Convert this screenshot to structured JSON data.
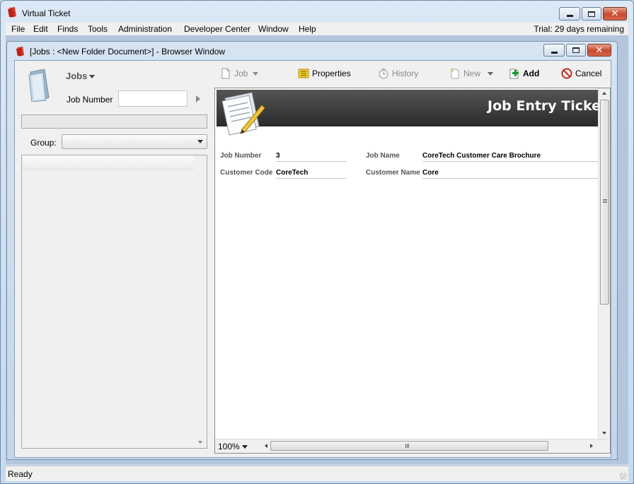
{
  "app": {
    "title": "Virtual Ticket",
    "trial_text": "Trial: 29 days remaining"
  },
  "menu": [
    "File",
    "Edit",
    "Finds",
    "Tools",
    "Administration",
    "Developer Center",
    "Window",
    "Help"
  ],
  "browser_window": {
    "title": "[Jobs : <New Folder Document>] - Browser Window"
  },
  "left_panel": {
    "jobs_label": "Jobs",
    "job_number_label": "Job Number",
    "job_number_value": "",
    "group_label": "Group:",
    "group_value": ""
  },
  "toolbar": {
    "job": "Job",
    "properties": "Properties",
    "history": "History",
    "new": "New",
    "add": "Add",
    "cancel": "Cancel"
  },
  "document": {
    "title": "Job Entry Ticket",
    "fields": {
      "job_number_label": "Job Number",
      "job_number_value": "3",
      "job_name_label": "Job Name",
      "job_name_value": "CoreTech Customer Care Brochure",
      "customer_code_label": "Customer Code",
      "customer_code_value": "CoreTech",
      "customer_name_label": "Customer Name",
      "customer_name_value": "Core"
    },
    "zoom": "100%"
  },
  "status": {
    "text": "Ready"
  },
  "colors": {
    "header_dark": "#2a2a2a",
    "add_green": "#1a9a2a",
    "cancel_red": "#c0281c",
    "properties_yellow": "#f2cf2e"
  }
}
